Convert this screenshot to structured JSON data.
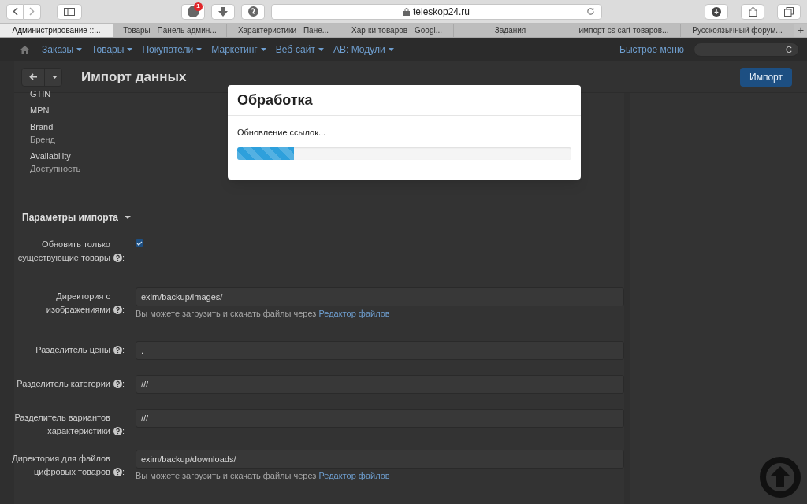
{
  "browser": {
    "adblock_badge": "1",
    "url": "teleskop24.ru",
    "tabs": [
      {
        "label": "Администрирование ::...",
        "selected": true
      },
      {
        "label": "Товары - Панель админ...",
        "selected": false
      },
      {
        "label": "Характеристики - Пане...",
        "selected": false
      },
      {
        "label": "Хар-ки товаров - Googl...",
        "selected": false
      },
      {
        "label": "Задания",
        "selected": false
      },
      {
        "label": "импорт cs cart товаров...",
        "selected": false
      },
      {
        "label": "Русскоязычный форум...",
        "selected": false
      }
    ],
    "new_tab": "+"
  },
  "nav": {
    "items": [
      "Заказы",
      "Товары",
      "Покупатели",
      "Маркетинг",
      "Веб-сайт",
      "AB: Модули"
    ],
    "quick_menu": "Быстрое меню",
    "search_value": "C"
  },
  "header": {
    "title": "Импорт данных",
    "import_button": "Импорт"
  },
  "fields": [
    {
      "label": "GTIN"
    },
    {
      "label": "MPN"
    },
    {
      "label": "Brand",
      "sublabel": "Бренд"
    },
    {
      "label": "Availability",
      "sublabel": "Доступность"
    }
  ],
  "section": {
    "title": "Параметры импорта",
    "expanded": true
  },
  "settings": [
    {
      "kind": "checkbox",
      "label": "Обновить только существующие товары",
      "suffix": ":",
      "checked": true
    },
    {
      "kind": "text",
      "label": "Директория с изображениями",
      "suffix": ":",
      "value": "exim/backup/images/",
      "hint": "Вы можете загрузить и скачать файлы через",
      "link": "Редактор файлов"
    },
    {
      "kind": "text",
      "label": "Разделитель цены",
      "suffix": ":",
      "value": "."
    },
    {
      "kind": "text",
      "label": "Разделитель категории",
      "suffix": ":",
      "value": "///"
    },
    {
      "kind": "text",
      "label": "Разделитель вариантов характеристики",
      "suffix": ":",
      "value": "///"
    },
    {
      "kind": "text",
      "label": "Директория для файлов цифровых товаров",
      "suffix": ":",
      "value": "exim/backup/downloads/",
      "hint": "Вы можете загрузить и скачать файлы через",
      "link": "Редактор файлов"
    }
  ],
  "modal": {
    "title": "Обработка",
    "message": "Обновление ссылок...",
    "level": 0.17
  }
}
